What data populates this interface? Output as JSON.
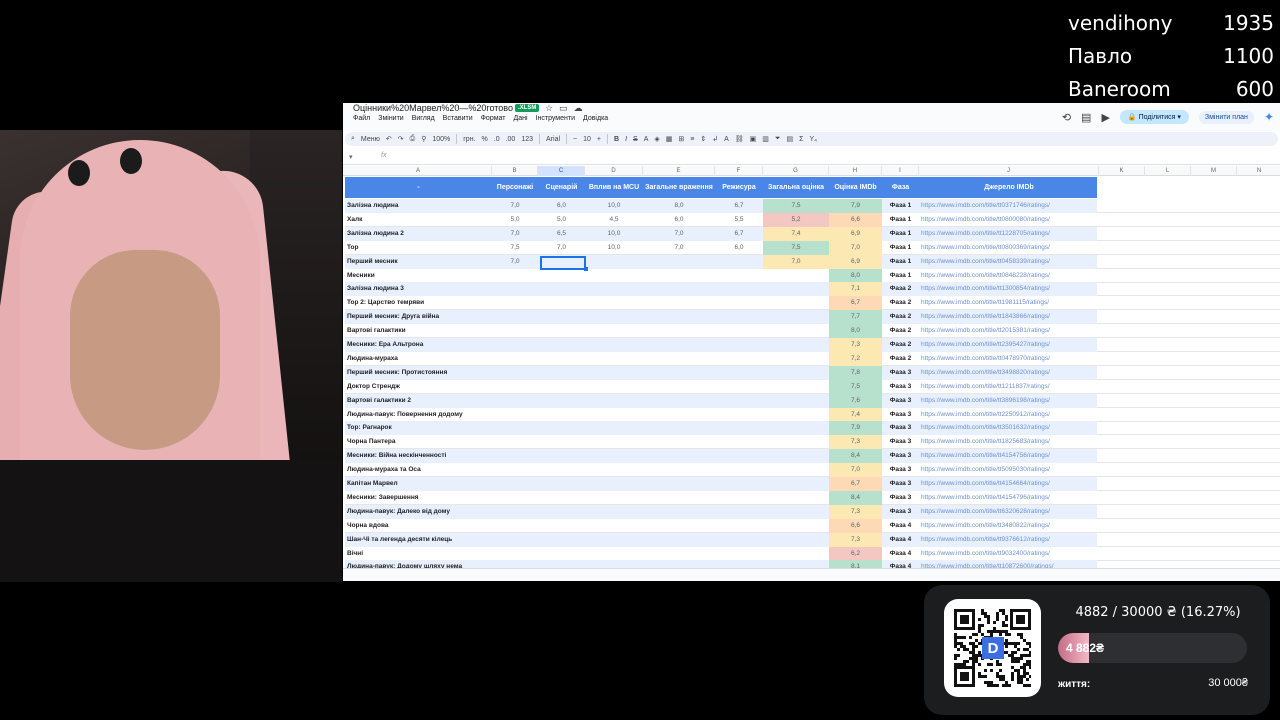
{
  "donors": [
    {
      "name": "vendihony",
      "amount": "1935"
    },
    {
      "name": "Павло",
      "amount": "1100"
    },
    {
      "name": "Baneroom",
      "amount": "600"
    }
  ],
  "sheet": {
    "title": "Оцінники%20Марвел%20—%20готово",
    "badge": ".XLSM",
    "menu": [
      "Файл",
      "Змінити",
      "Вигляд",
      "Вставити",
      "Формат",
      "Дані",
      "Інструменти",
      "Довідка"
    ],
    "share_label": "Поділитися",
    "plan_label": "Змінити план",
    "toolbar": {
      "menus": "Меню",
      "zoom": "100%",
      "currency": "грн.",
      "percent": "%",
      "format123": "123",
      "font": "Arial",
      "font_size": "10"
    },
    "fx_label": "fx",
    "columns": [
      "A",
      "B",
      "C",
      "D",
      "E",
      "F",
      "G",
      "H",
      "I",
      "J",
      "K",
      "L",
      "M",
      "N"
    ],
    "selected_column": "C",
    "header": [
      "-",
      "Персонажі",
      "Сценарій",
      "Вплив на MCU",
      "Загальне враження",
      "Режисура",
      "Загальна оцінка",
      "Оцінка IMDb",
      "Фаза",
      "Джерело IMDb"
    ],
    "rows": [
      {
        "name": "Залізна людина",
        "b": "7,0",
        "c": "6,0",
        "d": "10,0",
        "e": "8,0",
        "f": "6,7",
        "g": "7,5",
        "h": "7,9",
        "phase": "Фаза 1",
        "link": "https://www.imdb.com/title/tt0371746/ratings/"
      },
      {
        "name": "Халк",
        "b": "5,0",
        "c": "5,0",
        "d": "4,5",
        "e": "6,0",
        "f": "5,5",
        "g": "5,2",
        "h": "6,6",
        "phase": "Фаза 1",
        "link": "https://www.imdb.com/title/tt0800080/ratings/"
      },
      {
        "name": "Залізна людина 2",
        "b": "7,0",
        "c": "6,5",
        "d": "10,0",
        "e": "7,0",
        "f": "6,7",
        "g": "7,4",
        "h": "6,9",
        "phase": "Фаза 1",
        "link": "https://www.imdb.com/title/tt1228705/ratings/"
      },
      {
        "name": "Тор",
        "b": "7,5",
        "c": "7,0",
        "d": "10,0",
        "e": "7,0",
        "f": "6,0",
        "g": "7,5",
        "h": "7,0",
        "phase": "Фаза 1",
        "link": "https://www.imdb.com/title/tt0800369/ratings/"
      },
      {
        "name": "Перший месник",
        "b": "7,0",
        "c": "",
        "d": "",
        "e": "",
        "f": "",
        "g": "7,0",
        "h": "6,9",
        "phase": "Фаза 1",
        "link": "https://www.imdb.com/title/tt0458339/ratings/"
      },
      {
        "name": "Месники",
        "b": "",
        "c": "",
        "d": "",
        "e": "",
        "f": "",
        "g": "",
        "h": "8,0",
        "phase": "Фаза 1",
        "link": "https://www.imdb.com/title/tt0848228/ratings/"
      },
      {
        "name": "Залізна людина 3",
        "b": "",
        "c": "",
        "d": "",
        "e": "",
        "f": "",
        "g": "",
        "h": "7,1",
        "phase": "Фаза 2",
        "link": "https://www.imdb.com/title/tt1300854/ratings/"
      },
      {
        "name": "Тор 2: Царство темряви",
        "b": "",
        "c": "",
        "d": "",
        "e": "",
        "f": "",
        "g": "",
        "h": "6,7",
        "phase": "Фаза 2",
        "link": "https://www.imdb.com/title/tt1981115/ratings/"
      },
      {
        "name": "Перший месник: Друга війна",
        "b": "",
        "c": "",
        "d": "",
        "e": "",
        "f": "",
        "g": "",
        "h": "7,7",
        "phase": "Фаза 2",
        "link": "https://www.imdb.com/title/tt1843866/ratings/"
      },
      {
        "name": "Вартові галактики",
        "b": "",
        "c": "",
        "d": "",
        "e": "",
        "f": "",
        "g": "",
        "h": "8,0",
        "phase": "Фаза 2",
        "link": "https://www.imdb.com/title/tt2015381/ratings/"
      },
      {
        "name": "Месники: Ера Альтрона",
        "b": "",
        "c": "",
        "d": "",
        "e": "",
        "f": "",
        "g": "",
        "h": "7,3",
        "phase": "Фаза 2",
        "link": "https://www.imdb.com/title/tt2395427/ratings/"
      },
      {
        "name": "Людина-мураха",
        "b": "",
        "c": "",
        "d": "",
        "e": "",
        "f": "",
        "g": "",
        "h": "7,2",
        "phase": "Фаза 2",
        "link": "https://www.imdb.com/title/tt0478970/ratings/"
      },
      {
        "name": "Перший месник: Протистояння",
        "b": "",
        "c": "",
        "d": "",
        "e": "",
        "f": "",
        "g": "",
        "h": "7,8",
        "phase": "Фаза 3",
        "link": "https://www.imdb.com/title/tt3498820/ratings/"
      },
      {
        "name": "Доктор Стрендж",
        "b": "",
        "c": "",
        "d": "",
        "e": "",
        "f": "",
        "g": "",
        "h": "7,5",
        "phase": "Фаза 3",
        "link": "https://www.imdb.com/title/tt1211837/ratings/"
      },
      {
        "name": "Вартові галактики 2",
        "b": "",
        "c": "",
        "d": "",
        "e": "",
        "f": "",
        "g": "",
        "h": "7,6",
        "phase": "Фаза 3",
        "link": "https://www.imdb.com/title/tt3896198/ratings/"
      },
      {
        "name": "Людина-павук: Повернення додому",
        "b": "",
        "c": "",
        "d": "",
        "e": "",
        "f": "",
        "g": "",
        "h": "7,4",
        "phase": "Фаза 3",
        "link": "https://www.imdb.com/title/tt2250912/ratings/"
      },
      {
        "name": "Тор: Рагнарок",
        "b": "",
        "c": "",
        "d": "",
        "e": "",
        "f": "",
        "g": "",
        "h": "7,9",
        "phase": "Фаза 3",
        "link": "https://www.imdb.com/title/tt3501632/ratings/"
      },
      {
        "name": "Чорна Пантера",
        "b": "",
        "c": "",
        "d": "",
        "e": "",
        "f": "",
        "g": "",
        "h": "7,3",
        "phase": "Фаза 3",
        "link": "https://www.imdb.com/title/tt1825683/ratings/"
      },
      {
        "name": "Месники: Війна нескінченності",
        "b": "",
        "c": "",
        "d": "",
        "e": "",
        "f": "",
        "g": "",
        "h": "8,4",
        "phase": "Фаза 3",
        "link": "https://www.imdb.com/title/tt4154756/ratings/"
      },
      {
        "name": "Людина-мураха та Оса",
        "b": "",
        "c": "",
        "d": "",
        "e": "",
        "f": "",
        "g": "",
        "h": "7,0",
        "phase": "Фаза 3",
        "link": "https://www.imdb.com/title/tt5095030/ratings/"
      },
      {
        "name": "Капітан Марвел",
        "b": "",
        "c": "",
        "d": "",
        "e": "",
        "f": "",
        "g": "",
        "h": "6,7",
        "phase": "Фаза 3",
        "link": "https://www.imdb.com/title/tt4154664/ratings/"
      },
      {
        "name": "Месники: Завершення",
        "b": "",
        "c": "",
        "d": "",
        "e": "",
        "f": "",
        "g": "",
        "h": "8,4",
        "phase": "Фаза 3",
        "link": "https://www.imdb.com/title/tt4154796/ratings/"
      },
      {
        "name": "Людина-павук: Далеко від дому",
        "b": "",
        "c": "",
        "d": "",
        "e": "",
        "f": "",
        "g": "",
        "h": "7,3",
        "phase": "Фаза 3",
        "link": "https://www.imdb.com/title/tt6320628/ratings/"
      },
      {
        "name": "Чорна вдова",
        "b": "",
        "c": "",
        "d": "",
        "e": "",
        "f": "",
        "g": "",
        "h": "6,6",
        "phase": "Фаза 4",
        "link": "https://www.imdb.com/title/tt3480822/ratings/"
      },
      {
        "name": "Шан-Чі та легенда десяти кілець",
        "b": "",
        "c": "",
        "d": "",
        "e": "",
        "f": "",
        "g": "",
        "h": "7,3",
        "phase": "Фаза 4",
        "link": "https://www.imdb.com/title/tt9376612/ratings/"
      },
      {
        "name": "Вічні",
        "b": "",
        "c": "",
        "d": "",
        "e": "",
        "f": "",
        "g": "",
        "h": "6,2",
        "phase": "Фаза 4",
        "link": "https://www.imdb.com/title/tt9032400/ratings/"
      },
      {
        "name": "Людина-павук: Додому шляху нема",
        "b": "",
        "c": "",
        "d": "",
        "e": "",
        "f": "",
        "g": "",
        "h": "8,1",
        "phase": "Фаза 4",
        "link": "https://www.imdb.com/title/tt10872600/ratings/"
      }
    ],
    "colors": {
      "header_bg": "#4a86e8",
      "alt_row": "#e8f0fe",
      "green": "#b7e1cd",
      "yellow": "#fce8b2",
      "red": "#f4c7c3",
      "orange": "#fdd9b5"
    }
  },
  "donation": {
    "goal_text": "4882 / 30000 ₴ (16.27%)",
    "progress": 0.1627,
    "bar_label": "4 882₴",
    "goal_name": "життя:",
    "goal_target": "30 000₴",
    "qr_letter": "D"
  }
}
